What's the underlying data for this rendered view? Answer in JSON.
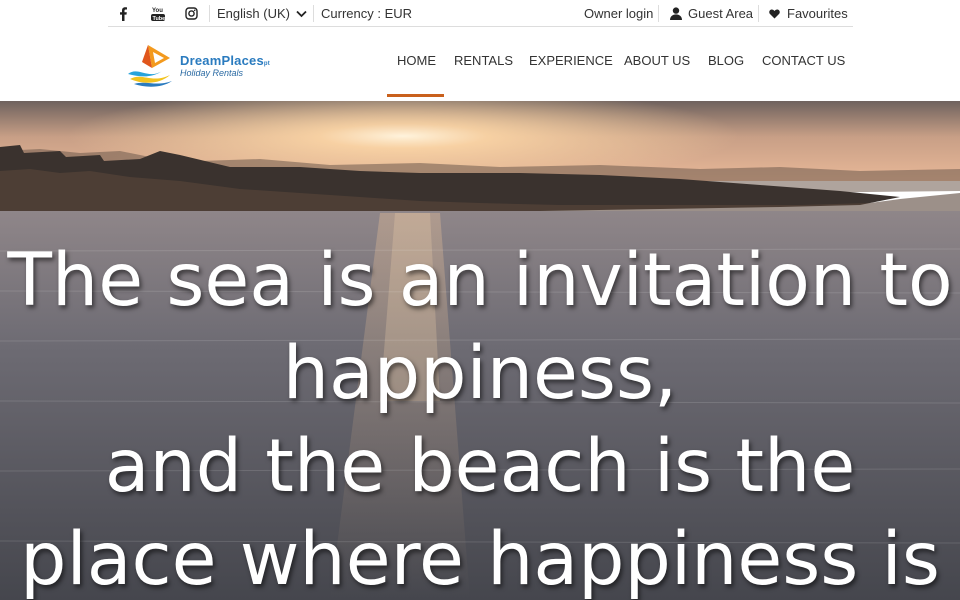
{
  "topbar": {
    "social": [
      {
        "icon": "facebook-icon",
        "label": "f"
      },
      {
        "icon": "youtube-icon",
        "label": "You"
      },
      {
        "icon": "instagram-icon",
        "label": ""
      }
    ],
    "language": "English (UK)",
    "currency": "Currency : EUR",
    "owner_login": "Owner login",
    "guest_area": "Guest Area",
    "favourites": "Favourites"
  },
  "logo": {
    "brand": "DreamPlaces",
    "suffix": "pt",
    "tagline": "Holiday Rentals"
  },
  "nav": {
    "items": [
      {
        "label": "HOME",
        "active": true
      },
      {
        "label": "RENTALS"
      },
      {
        "label": "EXPERIENCE"
      },
      {
        "label": "ABOUT US"
      },
      {
        "label": "BLOG"
      },
      {
        "label": "CONTACT US"
      }
    ]
  },
  "hero": {
    "lines": [
      "The sea is an invitation to",
      "happiness,",
      "and the beach is the",
      "place where happiness is"
    ]
  },
  "colors": {
    "accent": "#c9601c",
    "brand_blue": "#2a7bbf",
    "brand_orange": "#f39a1e"
  }
}
